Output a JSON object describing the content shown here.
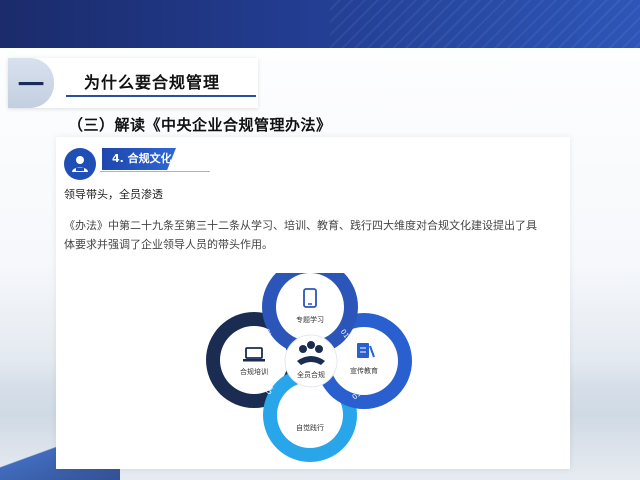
{
  "section": {
    "number": "一",
    "title": "为什么要合规管理"
  },
  "subheading": "（三）解读《中央企业合规管理办法》",
  "card": {
    "tag": "4. 合规文化",
    "subtitle": "领导带头，全员渗透",
    "body_line1": "《办法》中第二十九条至第三十二条从学习、培训、教育、践行四大维度对合规文化建设提出了具",
    "body_line2": "体要求并强调了企业领导人员的带头作用。"
  },
  "diagram": {
    "center": "全员合规",
    "top": {
      "label": "专题学习",
      "num": "01"
    },
    "right": {
      "label": "宣传教育",
      "num": "03"
    },
    "bottom": {
      "label": "自觉践行",
      "num": "04"
    },
    "left": {
      "label": "合规培训",
      "num": "02"
    }
  },
  "colors": {
    "banner": "#223c8f",
    "accent": "#1f4fb5",
    "ring_top": "#2b55b8",
    "ring_right": "#2a5fd0",
    "ring_bottom": "#29a6ea",
    "ring_left": "#1a2c52"
  },
  "icons": [
    "user-group-icon",
    "mobile-phone-icon",
    "document-pen-icon",
    "laptop-icon",
    "hands-together-icon"
  ]
}
